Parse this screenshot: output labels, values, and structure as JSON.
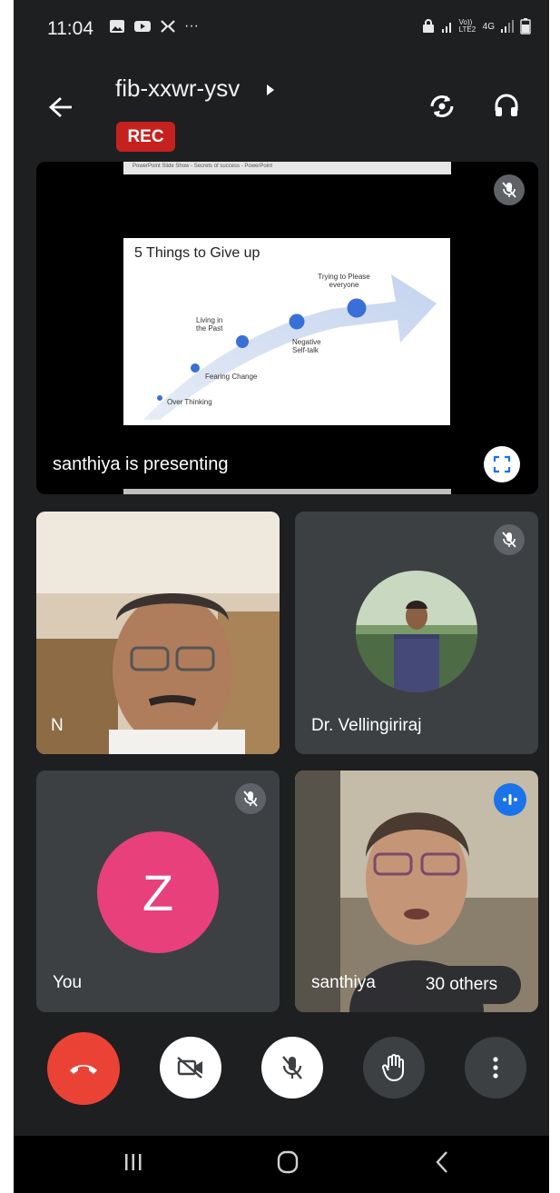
{
  "status_bar": {
    "time": "11:04",
    "left_icons": [
      "gallery-icon",
      "youtube-icon",
      "app-icon",
      "more-icon"
    ],
    "right_icons": [
      "lock-icon",
      "signal-icon",
      "volte-icon",
      "4g-icon",
      "signal2-icon",
      "battery-icon"
    ],
    "volte_label": "Vo)) LTE2",
    "network_label": "4G"
  },
  "header": {
    "meeting_code": "fib-xxwr-ysv",
    "recording_badge": "REC"
  },
  "presentation": {
    "presenter_label": "santhiya is presenting",
    "window_title": "PowerPoint Slide Show - Secrets of success - PowerPoint",
    "slide": {
      "title": "5 Things to Give up",
      "items": [
        "Over Thinking",
        "Fearing Change",
        "Living in the Past",
        "Negative Self-talk",
        "Trying to Please everyone"
      ]
    }
  },
  "participants": [
    {
      "name": "N",
      "muted": false
    },
    {
      "name": "Dr. Vellingiriraj",
      "muted": true
    },
    {
      "name": "You",
      "initial": "Z",
      "muted": true,
      "avatar_color": "#e8407a"
    },
    {
      "name": "santhiya",
      "speaking": true
    }
  ],
  "others_chip": "30 others",
  "controls": {
    "end_call_color": "#ea4335",
    "buttons": [
      "end-call",
      "camera-off",
      "mic-off",
      "raise-hand",
      "more-options"
    ]
  },
  "colors": {
    "background": "#1e1f21",
    "tile": "#3c4043",
    "accent_blue": "#1a73e8",
    "rec_red": "#c5221f"
  }
}
